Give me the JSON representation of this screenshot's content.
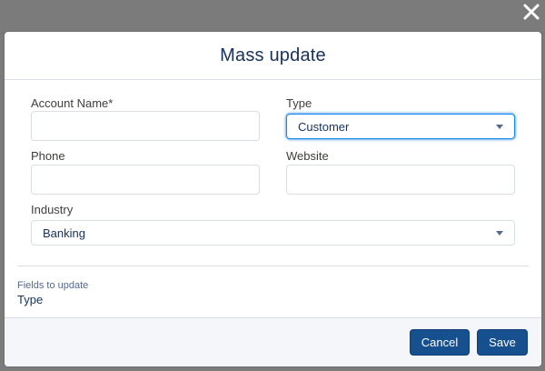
{
  "modal": {
    "title": "Mass update"
  },
  "form": {
    "account_name": {
      "label": "Account Name*",
      "value": ""
    },
    "type": {
      "label": "Type",
      "value": "Customer"
    },
    "phone": {
      "label": "Phone",
      "value": ""
    },
    "website": {
      "label": "Website",
      "value": ""
    },
    "industry": {
      "label": "Industry",
      "value": "Banking"
    }
  },
  "fields_to_update": {
    "caption": "Fields to update",
    "value": "Type"
  },
  "footer": {
    "cancel_label": "Cancel",
    "save_label": "Save"
  },
  "icons": {
    "close": "close-icon",
    "dropdown": "chevron-down-icon"
  },
  "colors": {
    "primary_button": "#16508f",
    "focus_border": "#1589ee",
    "title_text": "#16325c"
  }
}
